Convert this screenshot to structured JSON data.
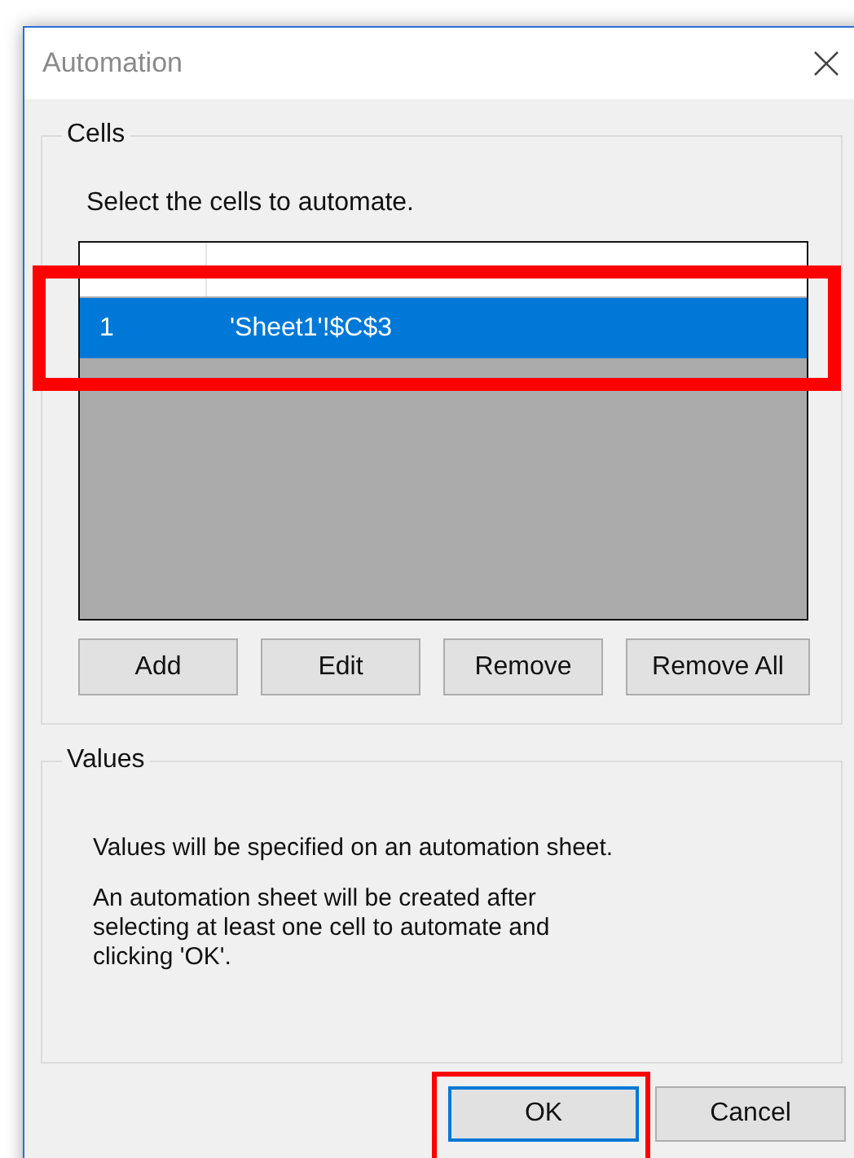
{
  "window": {
    "title": "Automation"
  },
  "cells_group": {
    "title": "Cells",
    "instruction": "Select the cells to automate.",
    "table": {
      "rows": [
        {
          "cells": [
            "1",
            "'Sheet1'!$C$3"
          ],
          "selected": true
        }
      ]
    },
    "buttons": [
      {
        "label": "Add"
      },
      {
        "label": "Edit"
      },
      {
        "label": "Remove"
      },
      {
        "label": "Remove All"
      }
    ]
  },
  "values_group": {
    "title": "Values",
    "paragraphs": [
      "Values will be specified on an automation sheet.",
      "An automation sheet will be created after selecting at least one cell to automate and clicking 'OK'."
    ]
  },
  "dialog_buttons": [
    {
      "label": "OK",
      "default": true
    },
    {
      "label": "Cancel",
      "default": false
    }
  ]
}
